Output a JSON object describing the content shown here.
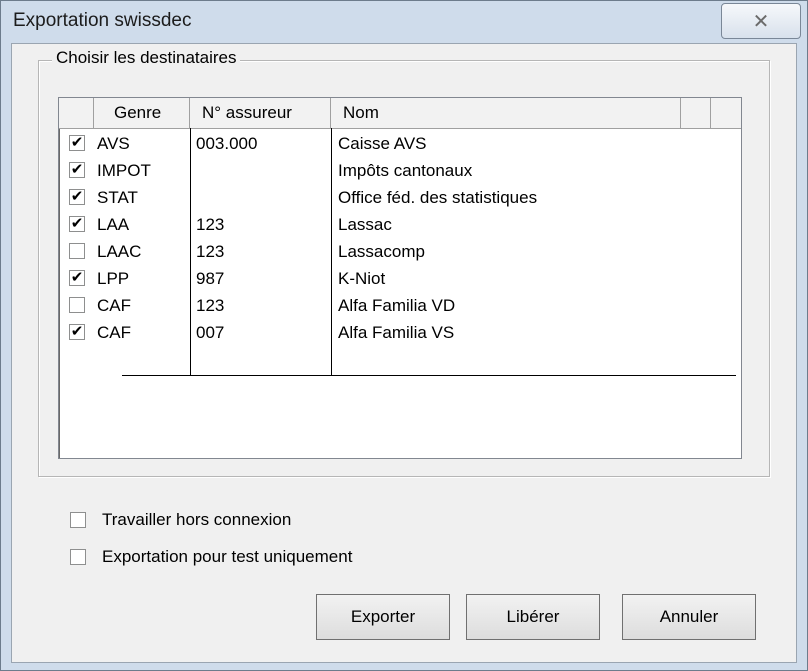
{
  "window": {
    "title": "Exportation swissdec",
    "close_icon": "close-icon"
  },
  "group": {
    "label": "Choisir les destinataires"
  },
  "columns": [
    "Genre",
    "N° assureur",
    "Nom"
  ],
  "rows": [
    {
      "checked": true,
      "genre": "AVS",
      "assureur": "003.000",
      "nom": "Caisse AVS"
    },
    {
      "checked": true,
      "genre": "IMPOT",
      "assureur": "",
      "nom": "Impôts cantonaux"
    },
    {
      "checked": true,
      "genre": "STAT",
      "assureur": "",
      "nom": "Office féd. des statistiques"
    },
    {
      "checked": true,
      "genre": "LAA",
      "assureur": "123",
      "nom": "Lassac"
    },
    {
      "checked": false,
      "genre": "LAAC",
      "assureur": "123",
      "nom": "Lassacomp"
    },
    {
      "checked": true,
      "genre": "LPP",
      "assureur": "987",
      "nom": "K-Niot"
    },
    {
      "checked": false,
      "genre": "CAF",
      "assureur": "123",
      "nom": "Alfa Familia VD"
    },
    {
      "checked": true,
      "genre": "CAF",
      "assureur": "007",
      "nom": "Alfa Familia VS"
    }
  ],
  "options": {
    "offline_label": "Travailler hors connexion",
    "offline_checked": false,
    "test_label": "Exportation pour test uniquement",
    "test_checked": false
  },
  "buttons": {
    "export": "Exporter",
    "release": "Libérer",
    "cancel": "Annuler"
  }
}
